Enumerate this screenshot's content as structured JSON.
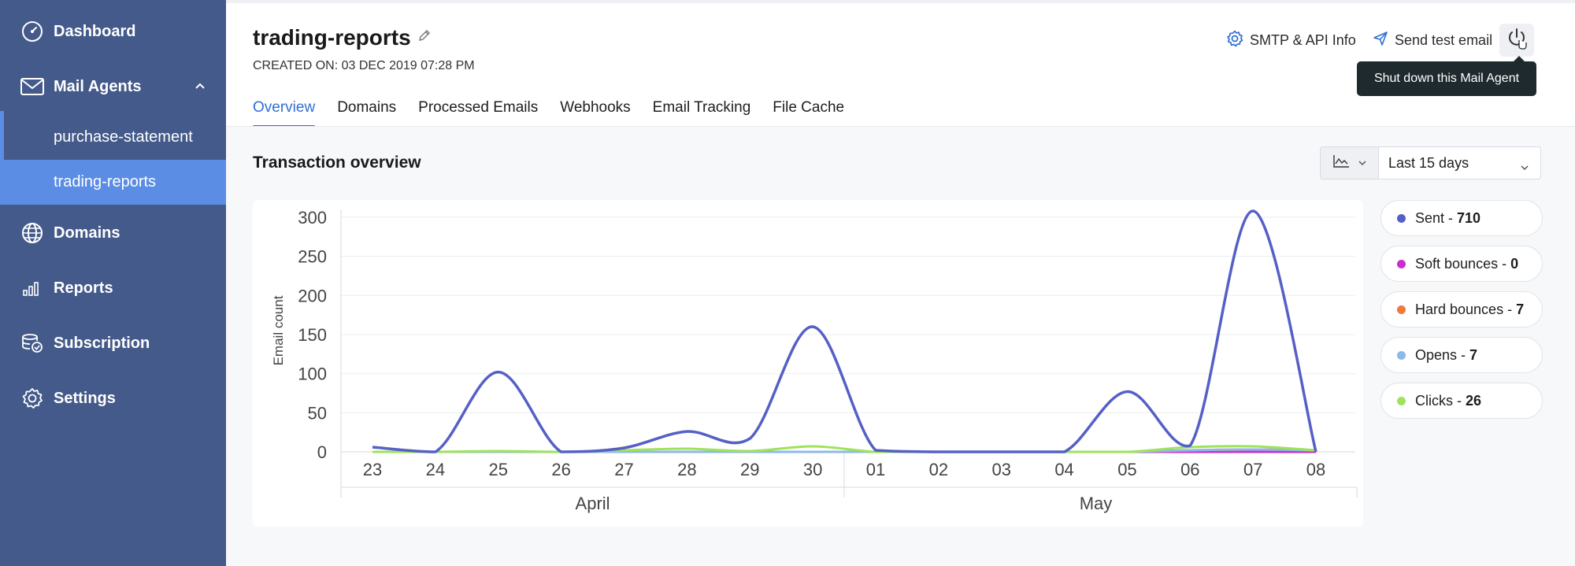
{
  "sidebar": {
    "items": [
      {
        "label": "Dashboard",
        "icon": "dashboard-gauge-icon"
      },
      {
        "label": "Mail Agents",
        "icon": "envelope-icon"
      },
      {
        "label": "Domains",
        "icon": "globe-icon"
      },
      {
        "label": "Reports",
        "icon": "bar-chart-icon"
      },
      {
        "label": "Subscription",
        "icon": "subscription-icon"
      },
      {
        "label": "Settings",
        "icon": "gear-icon"
      }
    ],
    "sub_items": [
      {
        "label": "purchase-statement"
      },
      {
        "label": "trading-reports",
        "active": true
      }
    ]
  },
  "header": {
    "title": "trading-reports",
    "created": "CREATED ON: 03 DEC 2019 07:28 PM",
    "smtp_label": "SMTP & API Info",
    "send_test_label": "Send test email",
    "tooltip": "Shut down this Mail Agent"
  },
  "tabs": [
    {
      "label": "Overview",
      "active": true
    },
    {
      "label": "Domains"
    },
    {
      "label": "Processed Emails"
    },
    {
      "label": "Webhooks"
    },
    {
      "label": "Email Tracking"
    },
    {
      "label": "File Cache"
    }
  ],
  "overview": {
    "section_title": "Transaction overview",
    "range_selected": "Last 15 days"
  },
  "colors": {
    "sidebar_bg": "#445a8a",
    "sidebar_active": "#5b8de4",
    "accent": "#2f6fd6",
    "sent": "#5560c6",
    "soft_bounces": "#c92fd0",
    "hard_bounces": "#ef7a3c",
    "opens": "#8db8ea",
    "clicks": "#9ee35a"
  },
  "legend": [
    {
      "name": "Sent",
      "sep": " - ",
      "value": "710",
      "color": "#5560c6"
    },
    {
      "name": "Soft bounces",
      "sep": " - ",
      "value": "0",
      "color": "#c92fd0"
    },
    {
      "name": "Hard bounces",
      "sep": " - ",
      "value": "7",
      "color": "#ef7a3c"
    },
    {
      "name": "Opens",
      "sep": " - ",
      "value": "7",
      "color": "#8db8ea"
    },
    {
      "name": "Clicks",
      "sep": " - ",
      "value": "26",
      "color": "#9ee35a"
    }
  ],
  "chart_data": {
    "type": "line",
    "title": "",
    "xlabel": "",
    "ylabel": "Email count",
    "x": [
      "23",
      "24",
      "25",
      "26",
      "27",
      "28",
      "29",
      "30",
      "01",
      "02",
      "03",
      "04",
      "05",
      "06",
      "07",
      "08"
    ],
    "month_labels": [
      {
        "label": "April",
        "from_index": 0,
        "to_index": 7
      },
      {
        "label": "May",
        "from_index": 8,
        "to_index": 15
      }
    ],
    "yticks": [
      0,
      50,
      100,
      150,
      200,
      250,
      300
    ],
    "ylim": [
      0,
      310
    ],
    "grid": true,
    "legend_position": "right",
    "series": [
      {
        "name": "Sent",
        "color": "#5560c6",
        "values": [
          6,
          0,
          102,
          0,
          5,
          26,
          17,
          160,
          2,
          0,
          0,
          0,
          77,
          8,
          308,
          0
        ]
      },
      {
        "name": "Soft bounces",
        "color": "#c92fd0",
        "values": [
          0,
          0,
          0,
          0,
          0,
          0,
          0,
          0,
          0,
          0,
          0,
          0,
          0,
          0,
          0,
          0
        ]
      },
      {
        "name": "Hard bounces",
        "color": "#ef7a3c",
        "values": [
          0,
          0,
          0,
          0,
          0,
          0,
          0,
          0,
          0,
          0,
          0,
          0,
          0,
          2,
          3,
          2
        ]
      },
      {
        "name": "Opens",
        "color": "#8db8ea",
        "values": [
          0,
          0,
          0,
          0,
          0,
          0,
          0,
          0,
          0,
          0,
          0,
          0,
          0,
          2,
          3,
          2
        ]
      },
      {
        "name": "Clicks",
        "color": "#9ee35a",
        "values": [
          0,
          0,
          1,
          0,
          2,
          4,
          1,
          7,
          0,
          0,
          0,
          0,
          0,
          6,
          7,
          2
        ]
      }
    ]
  }
}
